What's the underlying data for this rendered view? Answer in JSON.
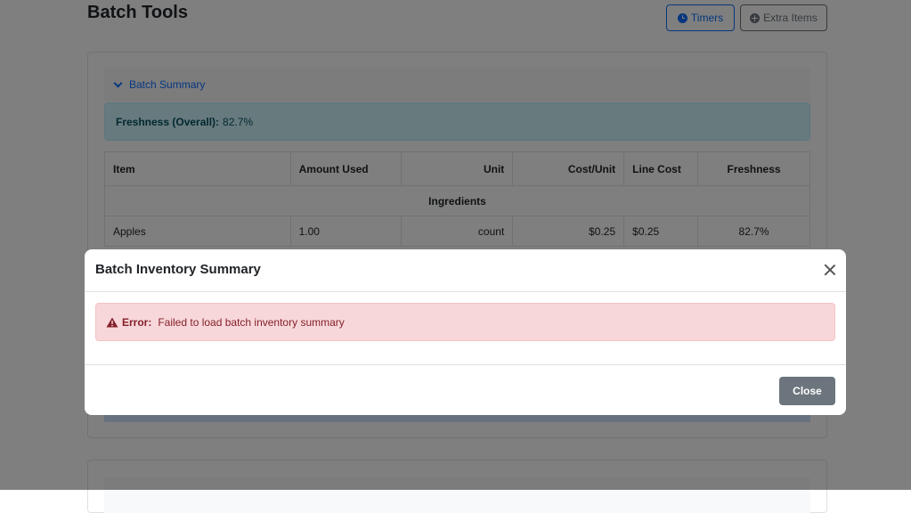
{
  "page": {
    "title": "Batch Tools"
  },
  "toolbar": {
    "timers_label": "Timers",
    "extra_items_label": "Extra Items"
  },
  "batch_summary": {
    "toggle_label": "Batch Summary",
    "freshness_label": "Freshness (Overall):",
    "freshness_value": "82.7%",
    "table": {
      "headers": [
        "Item",
        "Amount Used",
        "Unit",
        "Cost/Unit",
        "Line Cost",
        "Freshness"
      ],
      "group_label": "Ingredients",
      "rows": [
        {
          "item": "Apples",
          "amount": "1.00",
          "unit": "count",
          "cost_unit": "$0.25",
          "line_cost": "$0.25",
          "freshness": "82.7%"
        }
      ]
    }
  },
  "modal": {
    "title": "Batch Inventory Summary",
    "error_label": "Error:",
    "error_message": "Failed to load batch inventory summary",
    "close_button_label": "Close"
  },
  "colors": {
    "primary": "#0d6efd",
    "secondary": "#6c757d",
    "danger_bg": "#f8d7da",
    "danger_text": "#842029",
    "info_bg": "#cff4fc"
  }
}
